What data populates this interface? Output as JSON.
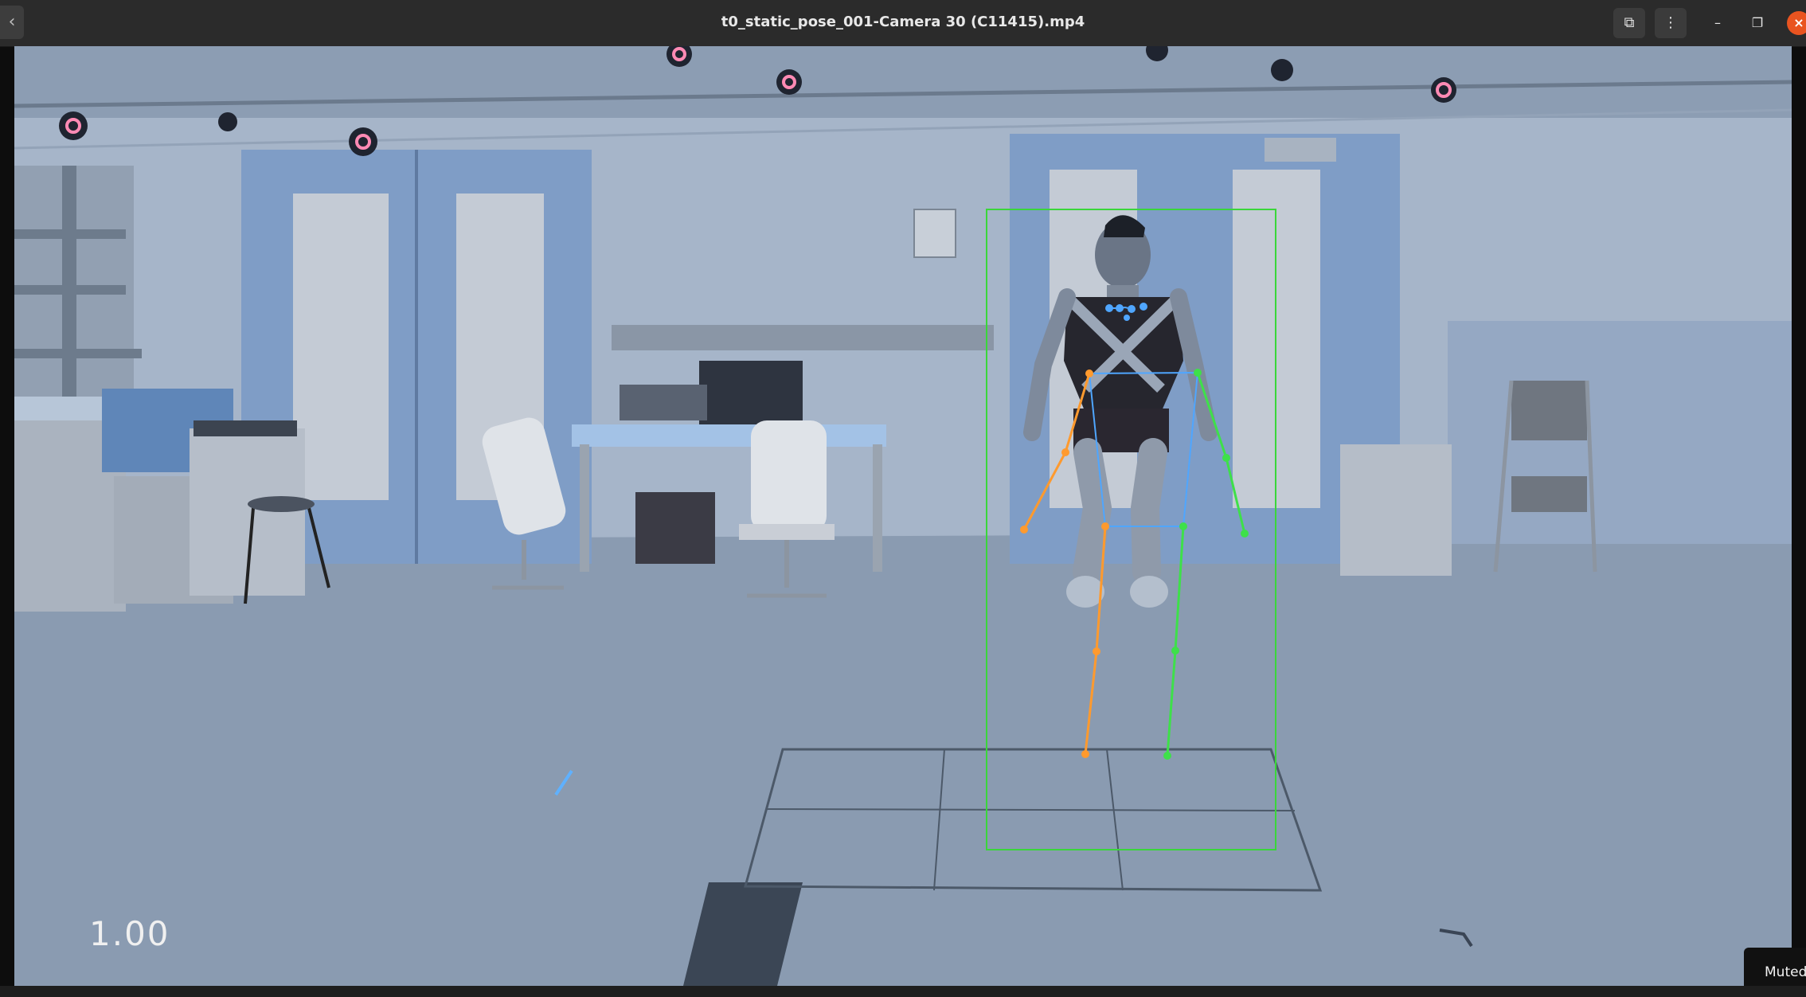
{
  "window": {
    "title": "t0_static_pose_001-Camera 30 (C11415).mp4",
    "back_icon": "‹",
    "pip_icon": "⧉",
    "menu_icon": "⋮",
    "minimize_icon": "–",
    "maximize_icon": "❐",
    "close_icon": "×"
  },
  "video": {
    "timecode": "1.00",
    "status": "Muted"
  },
  "colors": {
    "bbox": "#3ad63a",
    "left_limb": "#ff9a2e",
    "right_limb": "#3ee04a",
    "torso": "#4fa6ff"
  }
}
